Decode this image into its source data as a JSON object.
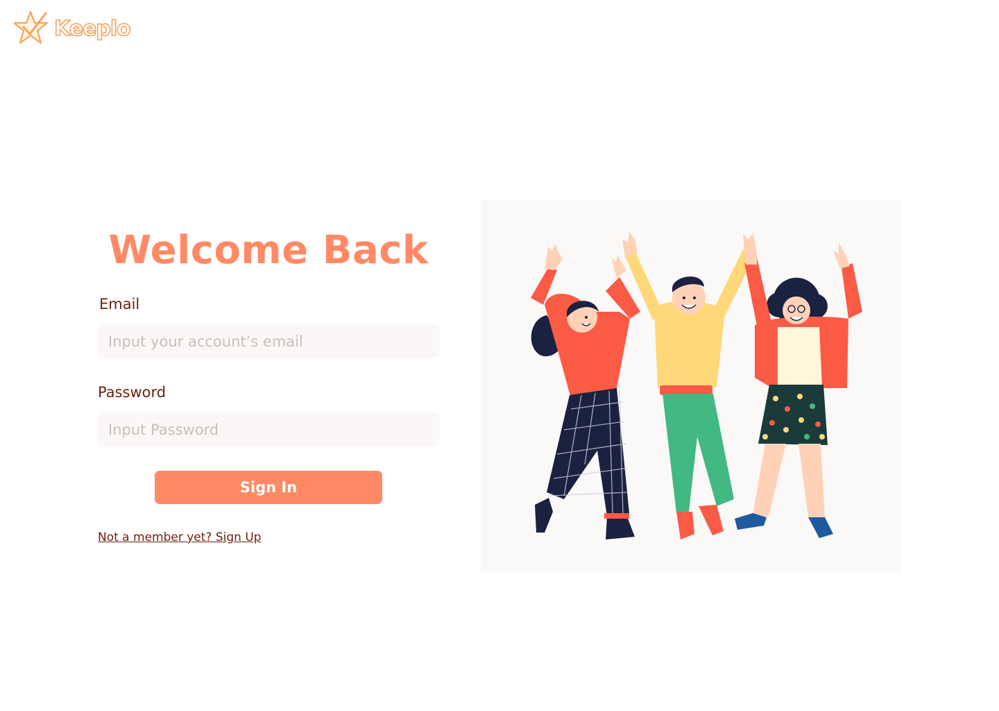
{
  "brand": {
    "name": "Keeplo",
    "logo_icon": "star-check-icon",
    "accent_color": "#ff8a65",
    "logo_color": "#f7a25a",
    "text_color": "#6b1f0c"
  },
  "login": {
    "title": "Welcome Back",
    "email_label": "Email",
    "email_placeholder": "Input your account’s email",
    "password_label": "Password",
    "password_placeholder": "Input Password",
    "signin_label": "Sign In",
    "signup_link": "Not a member yet? Sign Up"
  },
  "illustration": {
    "subject": "three-people-celebrating-illustration"
  }
}
